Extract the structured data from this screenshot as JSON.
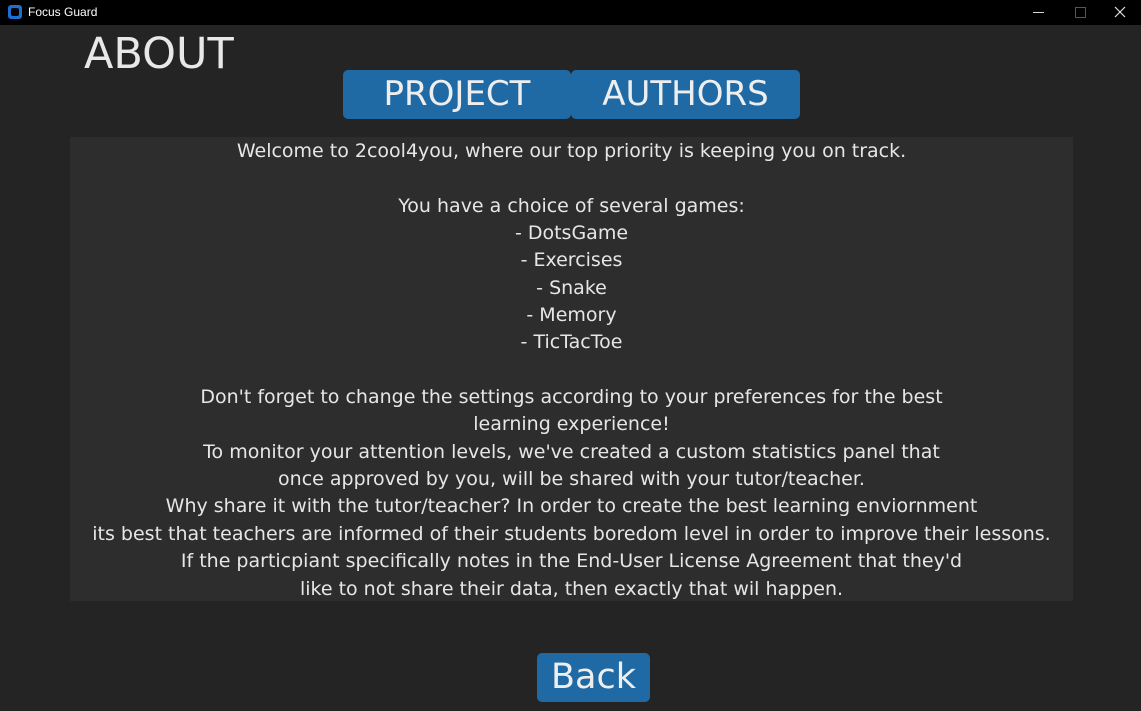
{
  "window": {
    "title": "Focus Guard",
    "controls": {
      "minimize_icon": "minimize-icon",
      "maximize_icon": "maximize-icon",
      "close_icon": "close-icon"
    }
  },
  "page": {
    "title": "ABOUT"
  },
  "tabs": [
    {
      "label": "PROJECT"
    },
    {
      "label": "AUTHORS"
    }
  ],
  "content": {
    "text": "Welcome to 2cool4you, where our top priority is keeping you on track.\n\nYou have a choice of several games:\n- DotsGame\n- Exercises\n- Snake\n- Memory\n- TicTacToe\n\nDon't forget to change the settings according to your preferences for the best\nlearning experience!\nTo monitor your attention levels, we've created a custom statistics panel that\nonce approved by you, will be shared with your tutor/teacher.\nWhy share it with the tutor/teacher? In order to create the best learning enviornment\nits best that teachers are informed of their students boredom level in order to improve their lessons.\nIf the particpiant specifically notes in the End-User License Agreement that they'd\nlike to not share their data, then exactly that wil happen."
  },
  "actions": {
    "back_label": "Back"
  },
  "colors": {
    "background": "#242424",
    "panel": "#2d2d2d",
    "accent": "#1f6aa5",
    "titlebar": "#000000",
    "text": "#e6e6e6"
  }
}
